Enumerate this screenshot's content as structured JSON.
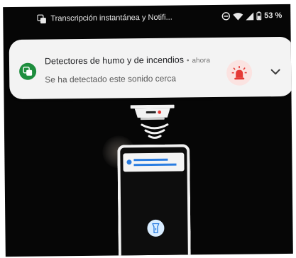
{
  "status_bar": {
    "title": "Transcripción instantánea y Notifi...",
    "battery": "53 %"
  },
  "notification": {
    "title": "Detectores de humo y de incendios",
    "separator": "•",
    "time": "ahora",
    "body": "Se ha detectado este sonido cerca"
  },
  "colors": {
    "app_icon": "#1e8e3e",
    "alarm": "#e53935",
    "accent": "#2a7de1"
  },
  "icons": {
    "status_app": "live-transcribe-icon",
    "dnd": "do-not-disturb-icon",
    "wifi": "wifi-icon",
    "signal": "cell-signal-icon",
    "battery": "battery-icon",
    "notif_app": "live-transcribe-icon",
    "alarm": "siren-icon",
    "expand": "chevron-down-icon",
    "detector": "smoke-detector-icon",
    "waves": "sound-waves-icon",
    "phone_app": "light-icon"
  }
}
